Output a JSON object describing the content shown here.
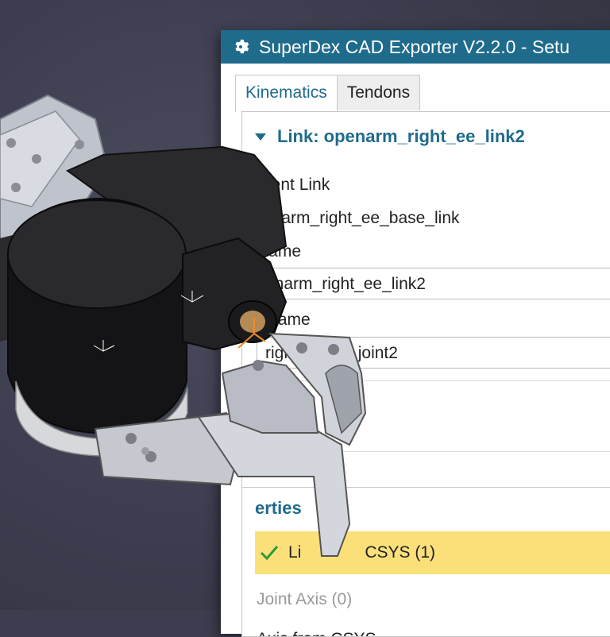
{
  "window": {
    "title": "SuperDex CAD Exporter V2.2.0 - Setu",
    "icon": "gear-icon",
    "accent": "#1f6b8c"
  },
  "tabs": [
    {
      "label": "Kinematics",
      "active": true
    },
    {
      "label": "Tendons",
      "active": false
    }
  ],
  "link_section": {
    "header": "Link: openarm_right_ee_link2",
    "parent_label": "arent Link",
    "parent_value": "enarm_right_ee_base_link",
    "name_label": "Name",
    "name_value": "enarm_right_ee_link2",
    "joint_label": "t Name",
    "joint_value": "right_finger_joint2"
  },
  "properties_section": {
    "header": "erties",
    "selected_item": "CSYS (1)",
    "selected_prefix": "Li",
    "selected_color": "#fbe07a",
    "joint_axis": "Joint Axis (0)",
    "axis_from": "Axis from CSYS"
  }
}
